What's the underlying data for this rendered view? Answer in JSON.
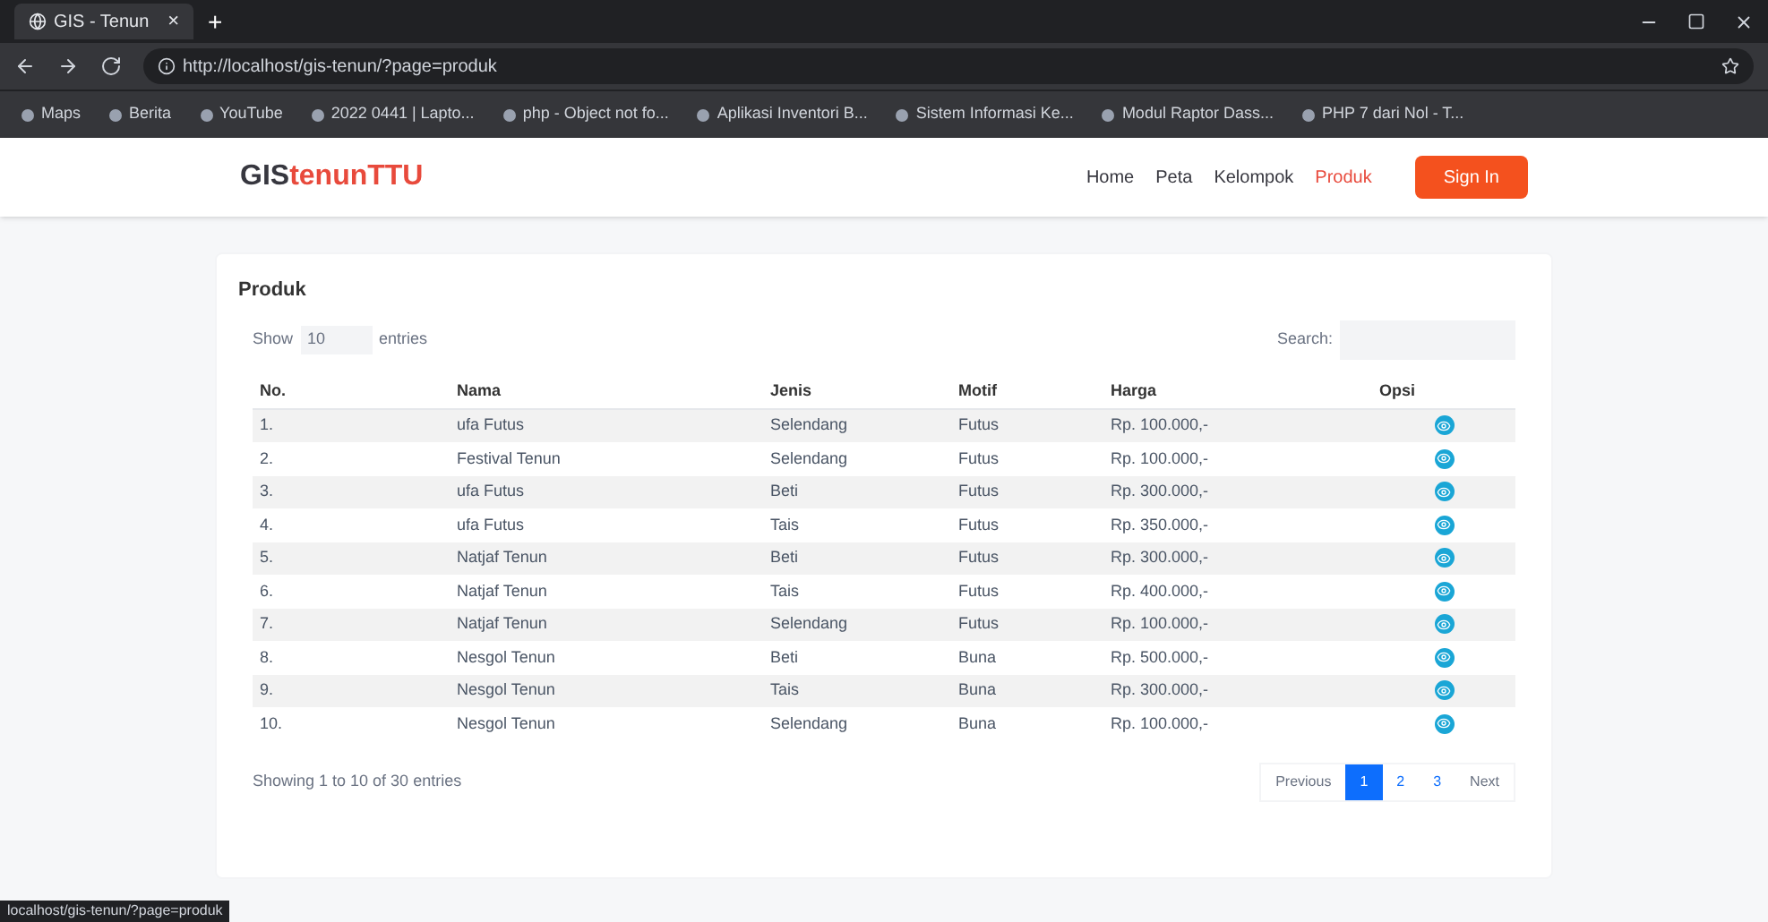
{
  "browser": {
    "tab_title": "GIS - Tenun",
    "tab_close": "×",
    "new_tab": "+",
    "url": "http://localhost/gis-tenun/?page=produk",
    "bookmarks": [
      "Maps",
      "Berita",
      "YouTube",
      "2022 0441 | Lapto...",
      "php - Object not fo...",
      "Aplikasi Inventori B...",
      "Sistem Informasi Ke...",
      "Modul Raptor Dass...",
      "PHP 7 dari Nol - T..."
    ]
  },
  "navbar": {
    "brand_dark": "GIS",
    "brand_red": "tenunTTU",
    "links": [
      {
        "label": "Home",
        "selected": false
      },
      {
        "label": "Peta",
        "selected": false
      },
      {
        "label": "Kelompok",
        "selected": false
      },
      {
        "label": "Produk",
        "selected": true
      }
    ],
    "button": "Sign In"
  },
  "card": {
    "title": "Produk",
    "show_label": "Show",
    "show_value": "10",
    "entries_label": "entries",
    "search_label": "Search:",
    "columns": [
      "No.",
      "Nama",
      "Jenis",
      "Motif",
      "Harga",
      "Opsi"
    ],
    "rows": [
      {
        "no": "1.",
        "nama": "ufa Futus",
        "jenis": "Selendang",
        "motif": "Futus",
        "harga": "Rp. 100.000,-"
      },
      {
        "no": "2.",
        "nama": "Festival Tenun",
        "jenis": "Selendang",
        "motif": "Futus",
        "harga": "Rp. 100.000,-"
      },
      {
        "no": "3.",
        "nama": "ufa Futus",
        "jenis": "Beti",
        "motif": "Futus",
        "harga": "Rp. 300.000,-"
      },
      {
        "no": "4.",
        "nama": "ufa Futus",
        "jenis": "Tais",
        "motif": "Futus",
        "harga": "Rp. 350.000,-"
      },
      {
        "no": "5.",
        "nama": "Natjaf Tenun",
        "jenis": "Beti",
        "motif": "Futus",
        "harga": "Rp. 300.000,-"
      },
      {
        "no": "6.",
        "nama": "Natjaf Tenun",
        "jenis": "Tais",
        "motif": "Futus",
        "harga": "Rp. 400.000,-"
      },
      {
        "no": "7.",
        "nama": "Natjaf Tenun",
        "jenis": "Selendang",
        "motif": "Futus",
        "harga": "Rp. 100.000,-"
      },
      {
        "no": "8.",
        "nama": "Nesgol Tenun",
        "jenis": "Beti",
        "motif": "Buna",
        "harga": "Rp. 500.000,-"
      },
      {
        "no": "9.",
        "nama": "Nesgol Tenun",
        "jenis": "Tais",
        "motif": "Buna",
        "harga": "Rp. 300.000,-"
      },
      {
        "no": "10.",
        "nama": "Nesgol Tenun",
        "jenis": "Selendang",
        "motif": "Buna",
        "harga": "Rp. 100.000,-"
      }
    ],
    "info": "Showing 1 to 10 of 30 entries",
    "pagination": [
      {
        "label": "Previous",
        "kind": "nav",
        "selected": false
      },
      {
        "label": "1",
        "kind": "page",
        "selected": true
      },
      {
        "label": "2",
        "kind": "page",
        "selected": false
      },
      {
        "label": "3",
        "kind": "page",
        "selected": false
      },
      {
        "label": "Next",
        "kind": "nav",
        "selected": false
      }
    ]
  },
  "status_url": "localhost/gis-tenun/?page=produk"
}
